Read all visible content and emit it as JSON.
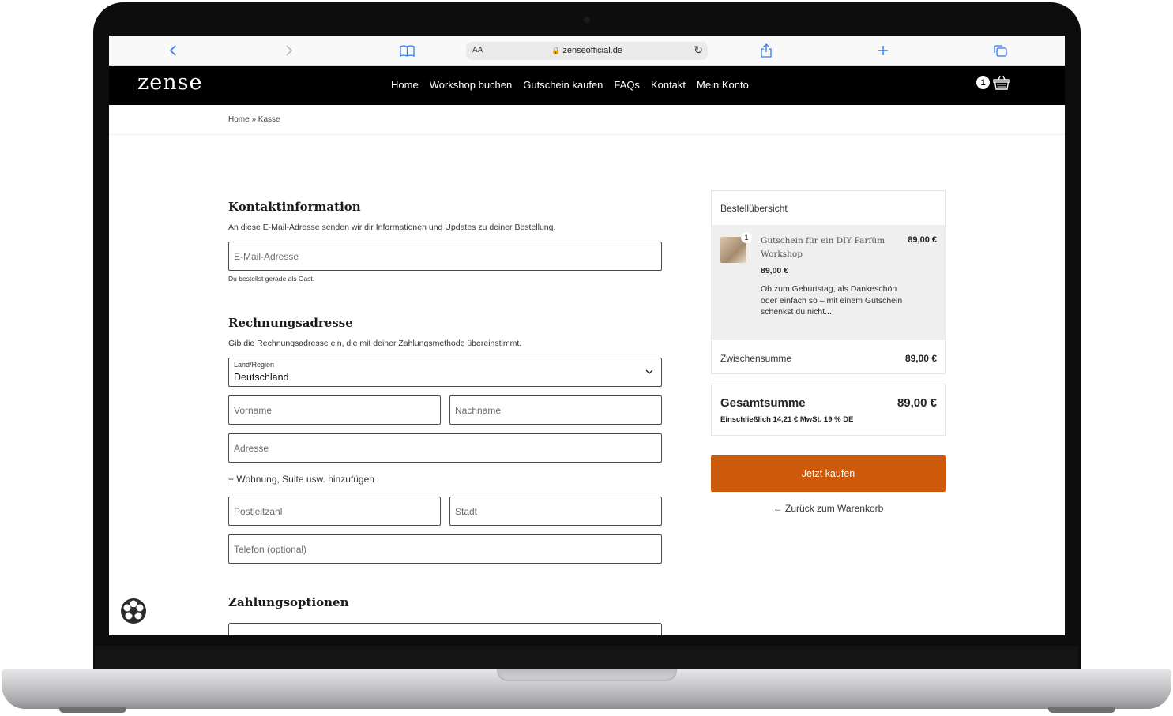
{
  "browser": {
    "reader_label": "AA",
    "url": "zenseofficial.de"
  },
  "site": {
    "logo": "zense",
    "nav": [
      "Home",
      "Workshop buchen",
      "Gutschein kaufen",
      "FAQs",
      "Kontakt",
      "Mein Konto"
    ],
    "cart_count": "1"
  },
  "breadcrumb": "Home » Kasse",
  "contact": {
    "title": "Kontaktinformation",
    "description": "An diese E-Mail-Adresse senden wir dir Informationen und Updates zu deiner Bestellung.",
    "email_placeholder": "E-Mail-Adresse",
    "guest_hint": "Du bestellst gerade als Gast."
  },
  "billing": {
    "title": "Rechnungsadresse",
    "description": "Gib die Rechnungsadresse ein, die mit deiner Zahlungsmethode übereinstimmt.",
    "country_label": "Land/Region",
    "country_value": "Deutschland",
    "first_name": "Vorname",
    "last_name": "Nachname",
    "address": "Adresse",
    "add_apartment": "+ Wohnung, Suite usw. hinzufügen",
    "postal_code": "Postleitzahl",
    "city": "Stadt",
    "phone": "Telefon (optional)"
  },
  "payment": {
    "title": "Zahlungsoptionen"
  },
  "summary": {
    "title": "Bestellübersicht",
    "item": {
      "quantity": "1",
      "name": "Gutschein für ein DIY Parfüm Workshop",
      "price_right": "89,00 €",
      "price": "89,00 €",
      "description": "Ob zum Geburtstag, als Dankeschön oder einfach so – mit einem Gutschein schenkst du nicht..."
    },
    "subtotal_label": "Zwischensumme",
    "subtotal_value": "89,00 €",
    "total_label": "Gesamtsumme",
    "total_value": "89,00 €",
    "tax_note": "Einschließlich 14,21 € MwSt. 19 % DE",
    "buy_button": "Jetzt kaufen",
    "back_link": "← Zurück zum Warenkorb"
  },
  "colors": {
    "accent": "#cc5a0a",
    "header_bg": "#000000",
    "browser_accent": "#2f7bf5"
  },
  "icons": [
    "back-icon",
    "forward-icon",
    "bookmarks-icon",
    "lock-icon",
    "reload-icon",
    "share-icon",
    "new-tab-icon",
    "tabs-icon",
    "basket-icon",
    "cookie-badge-icon",
    "chevron-down-icon"
  ]
}
